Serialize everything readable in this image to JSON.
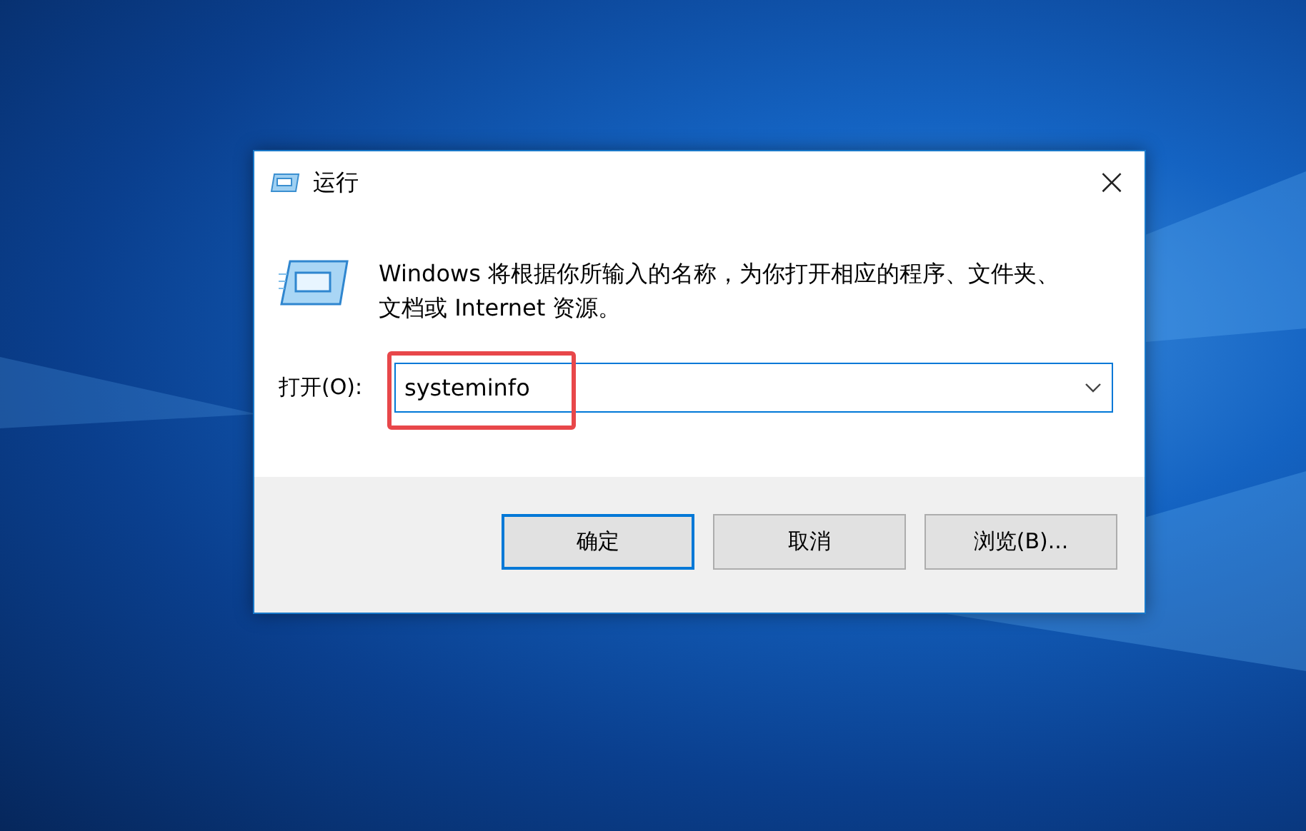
{
  "window": {
    "title": "运行",
    "close": "×"
  },
  "description": "Windows 将根据你所输入的名称，为你打开相应的程序、文件夹、文档或 Internet 资源。",
  "open_field": {
    "label": "打开(O):",
    "value": "systeminfo",
    "highlighted": true
  },
  "buttons": [
    {
      "label": "确定",
      "default": true
    },
    {
      "label": "取消",
      "default": false
    },
    {
      "label": "浏览(B)...",
      "default": false
    }
  ]
}
